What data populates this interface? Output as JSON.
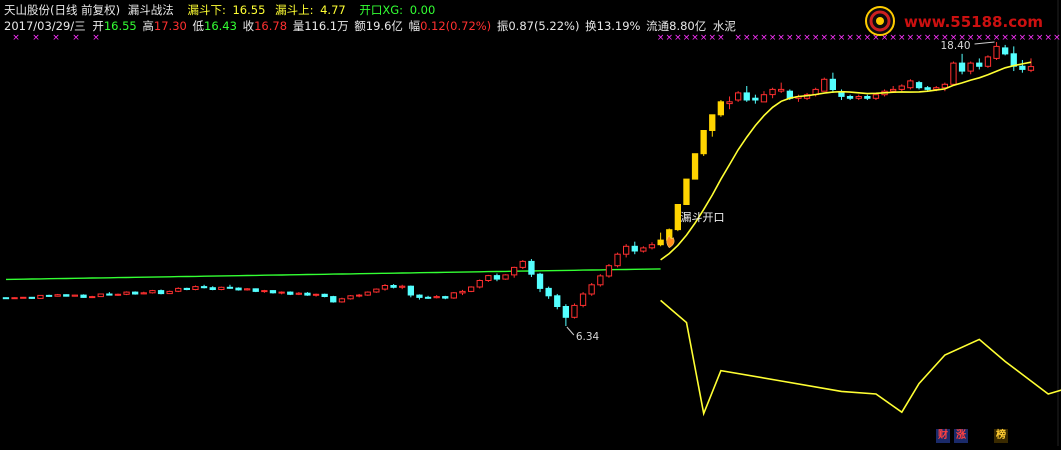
{
  "header": {
    "line1": {
      "stock": "天山股份(日线 前复权)",
      "indicator": "漏斗战法",
      "lower_label": "漏斗下:",
      "lower_value": "16.55",
      "upper_label": "漏斗上:",
      "upper_value": "4.77",
      "open_label": "开口XG:",
      "open_value": "0.00"
    },
    "line2": {
      "date": "2017/03/29/三",
      "open_label": "开",
      "open_value": "16.55",
      "high_label": "高",
      "high_value": "17.30",
      "low_label": "低",
      "low_value": "16.43",
      "close_label": "收",
      "close_value": "16.78",
      "vol_label": "量",
      "vol_value": "116.1万",
      "amt_label": "额",
      "amt_value": "19.6亿",
      "chg_label": "幅",
      "chg_value": "0.12(0.72%)",
      "amp_label": "振",
      "amp_value": "0.87(5.22%)",
      "turn_label": "换",
      "turn_value": "13.19%",
      "float_label": "流通",
      "float_value": "8.80亿",
      "sector": "水泥"
    }
  },
  "logo": {
    "text": "www.55188.com"
  },
  "badges": [
    "财",
    "涨",
    "榜"
  ],
  "colors": {
    "up": "#ff3030",
    "down": "#54ffff",
    "signal": "#ffd400",
    "green_line": "#33ff33",
    "yellow_line": "#ffff33",
    "magenta": "#ff33ff",
    "text": "#e8e8e8"
  },
  "chart_data": {
    "type": "candlestick",
    "annotations": [
      {
        "text": "18.40",
        "kind": "high-marker"
      },
      {
        "text": "6.34",
        "kind": "low-marker"
      },
      {
        "text": "漏斗开口",
        "kind": "label"
      }
    ],
    "candles": [
      [
        7.05,
        7.06,
        7.03,
        7.04
      ],
      [
        7.04,
        7.06,
        7.02,
        7.05
      ],
      [
        7.05,
        7.07,
        7.04,
        7.06
      ],
      [
        7.06,
        7.07,
        7.02,
        7.03
      ],
      [
        7.03,
        7.12,
        7.02,
        7.11
      ],
      [
        7.11,
        7.13,
        7.07,
        7.09
      ],
      [
        7.09,
        7.15,
        7.08,
        7.13
      ],
      [
        7.13,
        7.14,
        7.08,
        7.09
      ],
      [
        7.09,
        7.13,
        7.08,
        7.12
      ],
      [
        7.12,
        7.14,
        7.05,
        7.06
      ],
      [
        7.06,
        7.1,
        7.04,
        7.08
      ],
      [
        7.08,
        7.16,
        7.07,
        7.15
      ],
      [
        7.15,
        7.2,
        7.11,
        7.12
      ],
      [
        7.12,
        7.16,
        7.1,
        7.14
      ],
      [
        7.14,
        7.22,
        7.12,
        7.2
      ],
      [
        7.2,
        7.22,
        7.13,
        7.15
      ],
      [
        7.15,
        7.21,
        7.14,
        7.18
      ],
      [
        7.18,
        7.26,
        7.16,
        7.24
      ],
      [
        7.24,
        7.27,
        7.14,
        7.16
      ],
      [
        7.16,
        7.24,
        7.15,
        7.22
      ],
      [
        7.22,
        7.33,
        7.2,
        7.3
      ],
      [
        7.3,
        7.32,
        7.25,
        7.27
      ],
      [
        7.27,
        7.38,
        7.25,
        7.35
      ],
      [
        7.35,
        7.4,
        7.3,
        7.32
      ],
      [
        7.32,
        7.36,
        7.25,
        7.27
      ],
      [
        7.27,
        7.35,
        7.25,
        7.33
      ],
      [
        7.33,
        7.4,
        7.29,
        7.31
      ],
      [
        7.31,
        7.33,
        7.24,
        7.26
      ],
      [
        7.26,
        7.31,
        7.24,
        7.29
      ],
      [
        7.29,
        7.3,
        7.2,
        7.22
      ],
      [
        7.22,
        7.26,
        7.18,
        7.24
      ],
      [
        7.24,
        7.25,
        7.16,
        7.18
      ],
      [
        7.18,
        7.22,
        7.14,
        7.2
      ],
      [
        7.2,
        7.22,
        7.12,
        7.14
      ],
      [
        7.14,
        7.2,
        7.12,
        7.17
      ],
      [
        7.17,
        7.2,
        7.1,
        7.12
      ],
      [
        7.12,
        7.16,
        7.08,
        7.14
      ],
      [
        7.14,
        7.16,
        7.06,
        7.08
      ],
      [
        7.08,
        7.1,
        6.92,
        6.94
      ],
      [
        6.94,
        7.05,
        6.92,
        7.02
      ],
      [
        7.02,
        7.12,
        7.0,
        7.1
      ],
      [
        7.1,
        7.15,
        7.06,
        7.12
      ],
      [
        7.12,
        7.22,
        7.1,
        7.2
      ],
      [
        7.2,
        7.3,
        7.18,
        7.28
      ],
      [
        7.28,
        7.42,
        7.24,
        7.38
      ],
      [
        7.38,
        7.42,
        7.3,
        7.33
      ],
      [
        7.33,
        7.4,
        7.28,
        7.36
      ],
      [
        7.36,
        7.38,
        7.06,
        7.12
      ],
      [
        7.12,
        7.14,
        7.0,
        7.06
      ],
      [
        7.06,
        7.1,
        7.02,
        7.05
      ],
      [
        7.05,
        7.12,
        7.03,
        7.08
      ],
      [
        7.08,
        7.1,
        7.01,
        7.04
      ],
      [
        7.04,
        7.2,
        7.02,
        7.18
      ],
      [
        7.18,
        7.26,
        7.12,
        7.22
      ],
      [
        7.22,
        7.36,
        7.2,
        7.34
      ],
      [
        7.34,
        7.55,
        7.3,
        7.52
      ],
      [
        7.52,
        7.68,
        7.48,
        7.66
      ],
      [
        7.66,
        7.72,
        7.5,
        7.56
      ],
      [
        7.56,
        7.7,
        7.54,
        7.68
      ],
      [
        7.68,
        7.92,
        7.6,
        7.9
      ],
      [
        7.9,
        8.12,
        7.85,
        8.08
      ],
      [
        8.08,
        8.15,
        7.62,
        7.7
      ],
      [
        7.7,
        7.74,
        7.2,
        7.3
      ],
      [
        7.3,
        7.35,
        7.02,
        7.1
      ],
      [
        7.1,
        7.15,
        6.75,
        6.82
      ],
      [
        6.82,
        6.88,
        6.34,
        6.55
      ],
      [
        6.55,
        6.9,
        6.52,
        6.85
      ],
      [
        6.85,
        7.2,
        6.8,
        7.15
      ],
      [
        7.15,
        7.45,
        7.1,
        7.4
      ],
      [
        7.4,
        7.7,
        7.35,
        7.65
      ],
      [
        7.65,
        8.0,
        7.6,
        7.95
      ],
      [
        7.95,
        8.35,
        7.9,
        8.3
      ],
      [
        8.3,
        8.62,
        8.2,
        8.55
      ],
      [
        8.55,
        8.7,
        8.3,
        8.4
      ],
      [
        8.4,
        8.55,
        8.35,
        8.5
      ],
      [
        8.5,
        8.68,
        8.45,
        8.6
      ],
      [
        8.6,
        9.0,
        8.55,
        8.75
      ],
      [
        8.75,
        9.14,
        8.7,
        9.1
      ],
      [
        9.1,
        10.0,
        9.05,
        10.0
      ],
      [
        10.0,
        11.0,
        10.0,
        11.0
      ],
      [
        11.0,
        12.1,
        11.0,
        12.1
      ],
      [
        12.1,
        13.2,
        12.0,
        13.2
      ],
      [
        13.2,
        14.0,
        12.9,
        14.0
      ],
      [
        14.0,
        14.8,
        13.9,
        14.7
      ],
      [
        14.6,
        15.0,
        14.3,
        14.7
      ],
      [
        14.8,
        15.3,
        14.7,
        15.2
      ],
      [
        15.2,
        15.6,
        14.7,
        14.8
      ],
      [
        14.9,
        15.1,
        14.6,
        14.8
      ],
      [
        14.7,
        15.3,
        14.7,
        15.1
      ],
      [
        15.1,
        15.5,
        14.9,
        15.4
      ],
      [
        15.3,
        15.8,
        15.2,
        15.4
      ],
      [
        15.3,
        15.4,
        14.8,
        14.9
      ],
      [
        14.9,
        15.1,
        14.7,
        15.0
      ],
      [
        14.9,
        15.2,
        14.8,
        15.1
      ],
      [
        15.1,
        15.5,
        15.0,
        15.4
      ],
      [
        15.3,
        16.1,
        15.3,
        16.0
      ],
      [
        16.0,
        16.4,
        15.2,
        15.4
      ],
      [
        15.2,
        15.4,
        14.8,
        15.0
      ],
      [
        15.0,
        15.1,
        14.8,
        14.9
      ],
      [
        14.9,
        15.1,
        14.8,
        15.0
      ],
      [
        15.0,
        15.1,
        14.8,
        14.9
      ],
      [
        14.9,
        15.1,
        14.8,
        15.1
      ],
      [
        15.1,
        15.4,
        15.0,
        15.3
      ],
      [
        15.3,
        15.6,
        15.2,
        15.4
      ],
      [
        15.4,
        15.7,
        15.3,
        15.6
      ],
      [
        15.5,
        16.0,
        15.4,
        15.9
      ],
      [
        15.8,
        15.9,
        15.4,
        15.5
      ],
      [
        15.5,
        15.6,
        15.3,
        15.4
      ],
      [
        15.4,
        15.6,
        15.3,
        15.5
      ],
      [
        15.5,
        15.8,
        15.3,
        15.7
      ],
      [
        15.7,
        17.1,
        15.6,
        17.0
      ],
      [
        17.0,
        17.6,
        16.3,
        16.5
      ],
      [
        16.5,
        17.1,
        16.3,
        17.0
      ],
      [
        17.0,
        17.3,
        16.6,
        16.8
      ],
      [
        16.8,
        17.5,
        16.7,
        17.4
      ],
      [
        17.3,
        18.4,
        17.2,
        18.1
      ],
      [
        18.0,
        18.2,
        17.5,
        17.6
      ],
      [
        17.6,
        18.1,
        16.5,
        16.8
      ],
      [
        16.8,
        17.2,
        16.4,
        16.6
      ],
      [
        16.55,
        17.3,
        16.43,
        16.78
      ]
    ],
    "signal_days": [
      76,
      77,
      78,
      79,
      80,
      81,
      82,
      83,
      85,
      86,
      87,
      88,
      89,
      90,
      91,
      92,
      93,
      94,
      95,
      96,
      97,
      98,
      99,
      100,
      101,
      102,
      103,
      104,
      105,
      106,
      107,
      108,
      109,
      110,
      111,
      112,
      113,
      114,
      115,
      116,
      117,
      118,
      119,
      120,
      121,
      122,
      123,
      124,
      125
    ],
    "funnel_upper": "green-line",
    "funnel_lower": "yellow-line"
  }
}
